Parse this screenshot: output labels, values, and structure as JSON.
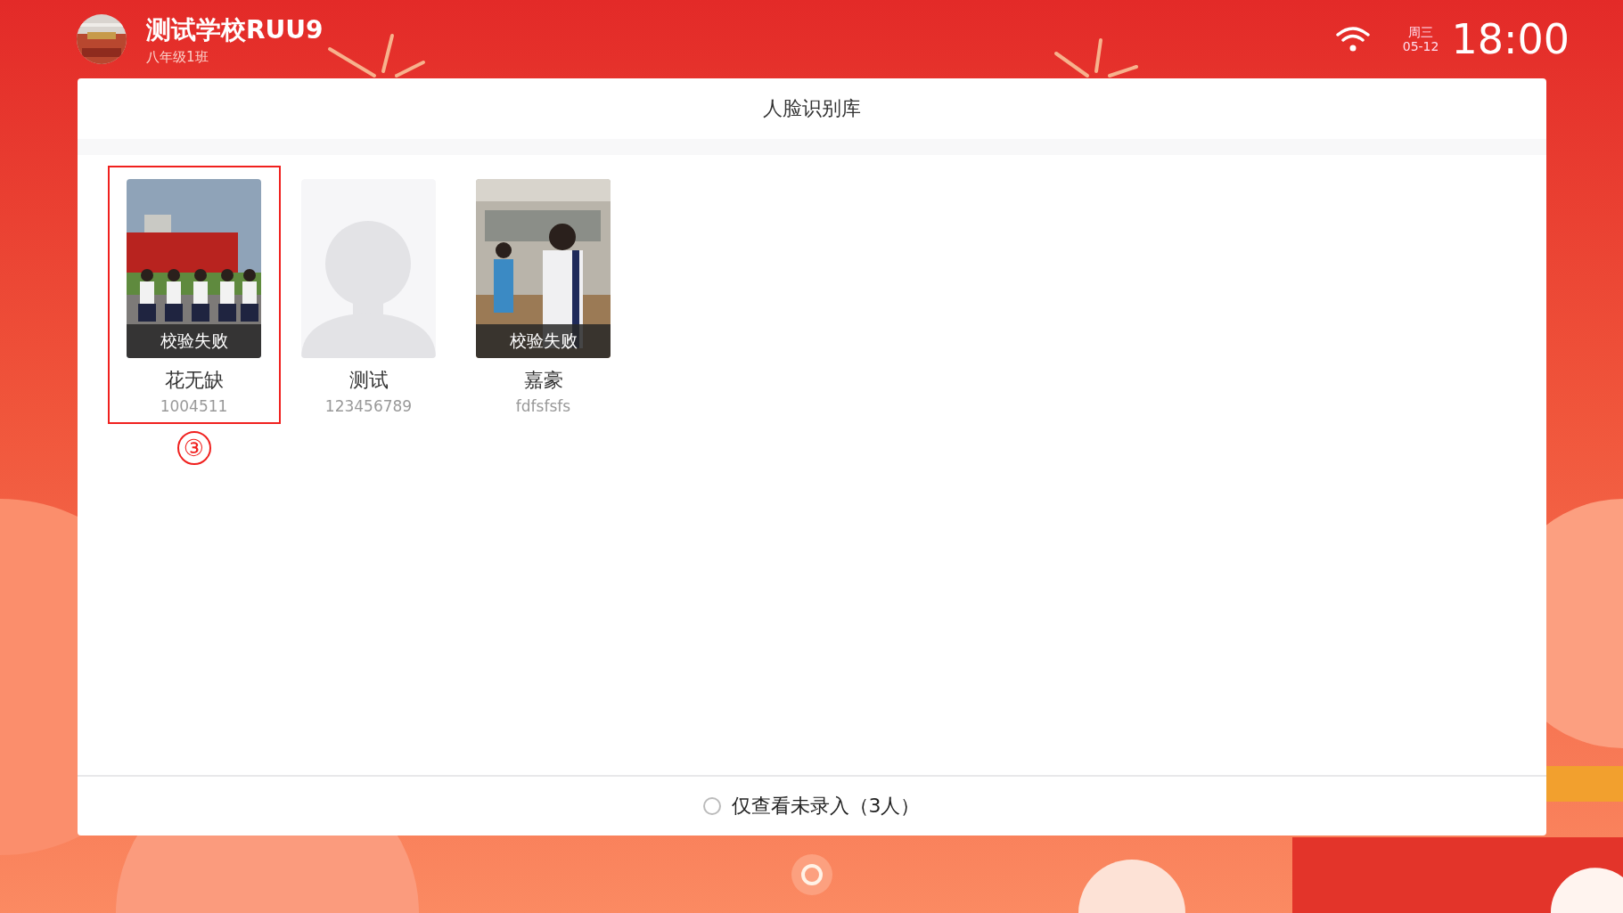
{
  "header": {
    "school": "测试学校RUU9",
    "class_name": "八年级1班",
    "weekday": "周三",
    "date": "05-12",
    "time": "18:00"
  },
  "panel": {
    "title": "人脸识别库",
    "cards": [
      {
        "status": "校验失败",
        "name": "花无缺",
        "id": "1004511",
        "highlighted": true,
        "annotation": "③"
      },
      {
        "kind": "placeholder",
        "name": "测试",
        "id": "123456789",
        "highlighted": false
      },
      {
        "status": "校验失败",
        "name": "嘉豪",
        "id": "fdfsfsfs",
        "highlighted": false
      }
    ],
    "filter": {
      "label": "仅查看未录入（3人）",
      "checked": false
    }
  }
}
